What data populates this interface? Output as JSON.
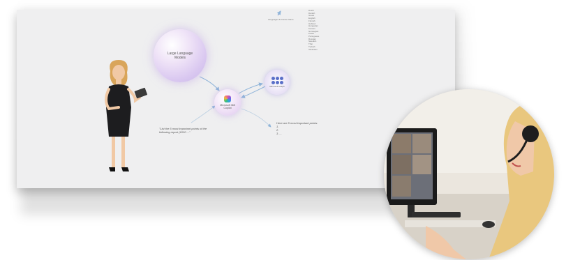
{
  "slide": {
    "llm_label": "Large Language Models",
    "copilot_label": "Microsoft 365 Copilot",
    "graph_label": "Microsoft Graph",
    "languages_label": "Languages & France Name",
    "languages": [
      "Dutch",
      "Danish",
      "Greek",
      "English",
      "Finnish",
      "Hebrew",
      "Hungarian",
      "Korean",
      "Norwegian",
      "Polish",
      "Portuguese",
      "Russian",
      "Swedish",
      "Thai",
      "Turkish",
      "Ukrainian"
    ],
    "prompt": "\"List the 5 most important points of the following report (1020 ...\"",
    "answer_title": "Here are 5 most important points:",
    "answer_lines": [
      "1.",
      "2.",
      "3. ..."
    ]
  },
  "colors": {
    "slide_bg": "#efeff0",
    "llm_glow": "#d9c7f0",
    "copilot_glow": "#ddc8ee",
    "arrow": "#8fb4d9",
    "dress": "#1d1d1f",
    "hair": "#d9a55a"
  },
  "icons": {
    "copilot": "copilot-logo-icon",
    "graph": "graph-dots-icon",
    "arrow": "arrow-icon",
    "headset": "headset-icon"
  }
}
